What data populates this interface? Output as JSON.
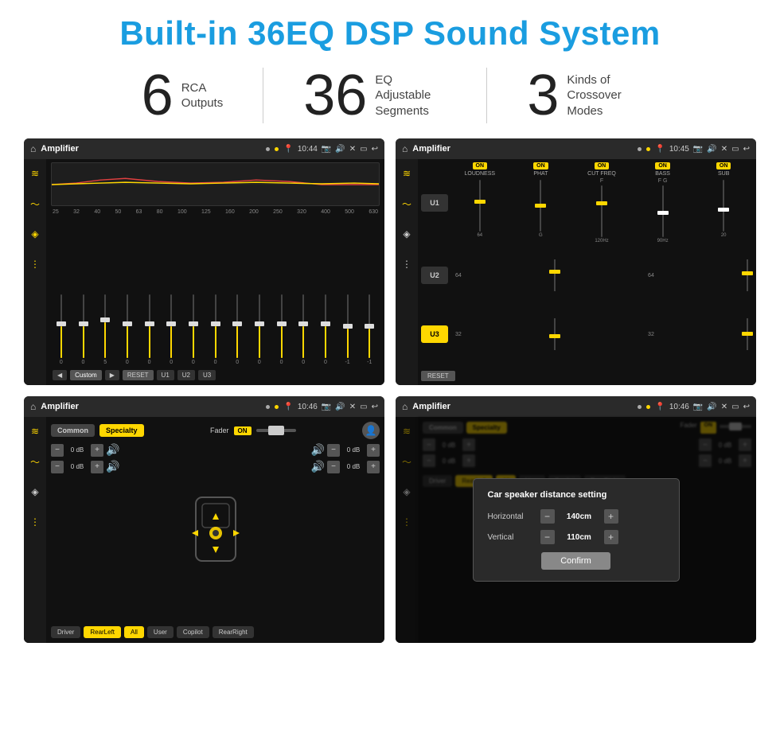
{
  "header": {
    "title": "Built-in 36EQ DSP Sound System"
  },
  "stats": [
    {
      "number": "6",
      "line1": "RCA",
      "line2": "Outputs"
    },
    {
      "number": "36",
      "line1": "EQ Adjustable",
      "line2": "Segments"
    },
    {
      "number": "3",
      "line1": "Kinds of",
      "line2": "Crossover Modes"
    }
  ],
  "screen1": {
    "title": "Amplifier",
    "time": "10:44",
    "freqs": [
      "25",
      "32",
      "40",
      "50",
      "63",
      "80",
      "100",
      "125",
      "160",
      "200",
      "250",
      "320",
      "400",
      "500",
      "630"
    ],
    "vals": [
      "0",
      "0",
      "5",
      "0",
      "0",
      "0",
      "0",
      "0",
      "0",
      "0",
      "0",
      "0",
      "0",
      "-1",
      "-1"
    ],
    "buttons": [
      "Custom",
      "RESET",
      "U1",
      "U2",
      "U3"
    ]
  },
  "screen2": {
    "title": "Amplifier",
    "time": "10:45",
    "uButtons": [
      "U1",
      "U2",
      "U3"
    ],
    "uActive": 2,
    "controls": [
      "LOUDNESS",
      "PHAT",
      "CUT FREQ",
      "BASS",
      "SUB"
    ]
  },
  "screen3": {
    "title": "Amplifier",
    "time": "10:46",
    "tabs": [
      "Common",
      "Specialty"
    ],
    "faderLabel": "Fader",
    "dbValues": [
      "0 dB",
      "0 dB",
      "0 dB",
      "0 dB"
    ],
    "bottomButtons": [
      "Driver",
      "RearLeft",
      "All",
      "User",
      "Copilot",
      "RearRight"
    ]
  },
  "screen4": {
    "title": "Amplifier",
    "time": "10:46",
    "dialog": {
      "title": "Car speaker distance setting",
      "rows": [
        {
          "label": "Horizontal",
          "value": "140cm"
        },
        {
          "label": "Vertical",
          "value": "110cm"
        }
      ],
      "confirmLabel": "Confirm"
    }
  }
}
